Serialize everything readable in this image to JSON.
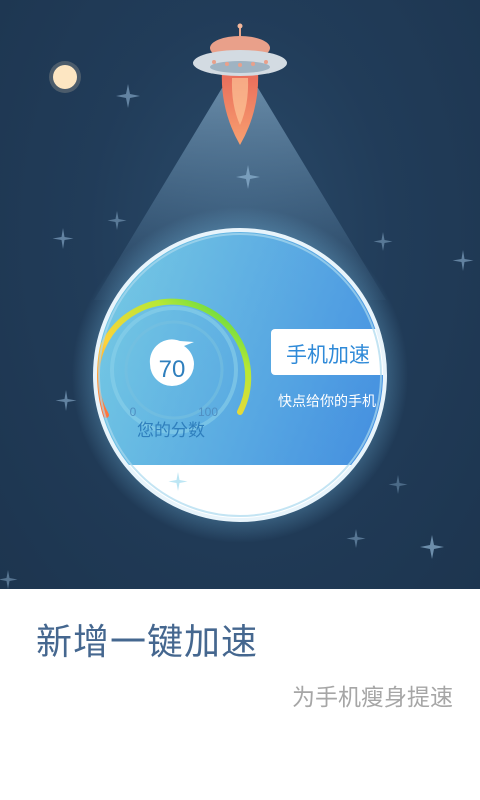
{
  "screen": {
    "name": "feature-intro-speedup"
  },
  "colors": {
    "sky": "#213c59",
    "card_blue": "#3f97e3",
    "headline": "#45678f",
    "subline": "#a6a6a6",
    "score_text": "#2f7fbd",
    "beam": "#7ea7c6"
  },
  "icons": {
    "ufo": "ufo-icon",
    "rocket_flame": "rocket-icon",
    "moon": "moon-icon",
    "stars": "sparkle-star-icon"
  },
  "gauge": {
    "score": "70",
    "min_label": "0",
    "max_label": "100",
    "caption": "您的分数",
    "score_fraction": 0.7
  },
  "card": {
    "button_label": "手机加速",
    "tagline": "快点给你的手机"
  },
  "text": {
    "headline": "新增一键加速",
    "subline": "为手机瘦身提速"
  }
}
